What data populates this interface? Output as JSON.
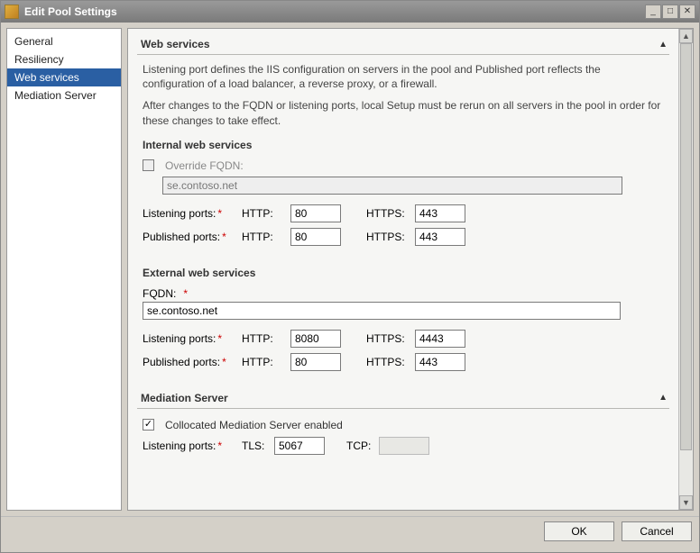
{
  "window": {
    "title": "Edit Pool Settings",
    "btn_min": "_",
    "btn_max": "□",
    "btn_close": "✕"
  },
  "sidebar": {
    "items": [
      {
        "label": "General"
      },
      {
        "label": "Resiliency"
      },
      {
        "label": "Web services"
      },
      {
        "label": "Mediation Server"
      }
    ]
  },
  "sections": {
    "web": {
      "header": "Web services",
      "desc1": "Listening port defines the IIS configuration on servers in the pool and Published port reflects the configuration of a load balancer, a reverse proxy, or a firewall.",
      "desc2": "After changes to the FQDN or listening ports, local Setup must be rerun on all servers in the pool in order for these changes to take effect.",
      "internal": {
        "heading": "Internal web services",
        "override_label": "Override FQDN:",
        "override_checked": false,
        "fqdn_value": "se.contoso.net",
        "listening_label": "Listening ports:",
        "published_label": "Published ports:",
        "http_label": "HTTP:",
        "https_label": "HTTPS:",
        "listen_http": "80",
        "listen_https": "443",
        "pub_http": "80",
        "pub_https": "443"
      },
      "external": {
        "heading": "External web services",
        "fqdn_label": "FQDN:",
        "fqdn_value": "se.contoso.net",
        "listening_label": "Listening ports:",
        "published_label": "Published ports:",
        "http_label": "HTTP:",
        "https_label": "HTTPS:",
        "listen_http": "8080",
        "listen_https": "4443",
        "pub_http": "80",
        "pub_https": "443"
      }
    },
    "mediation": {
      "header": "Mediation Server",
      "collocated_label": "Collocated Mediation Server enabled",
      "collocated_checked": true,
      "listening_label": "Listening ports:",
      "tls_label": "TLS:",
      "tls_value": "5067",
      "tcp_label": "TCP:",
      "tcp_value": ""
    }
  },
  "buttons": {
    "ok": "OK",
    "cancel": "Cancel"
  }
}
